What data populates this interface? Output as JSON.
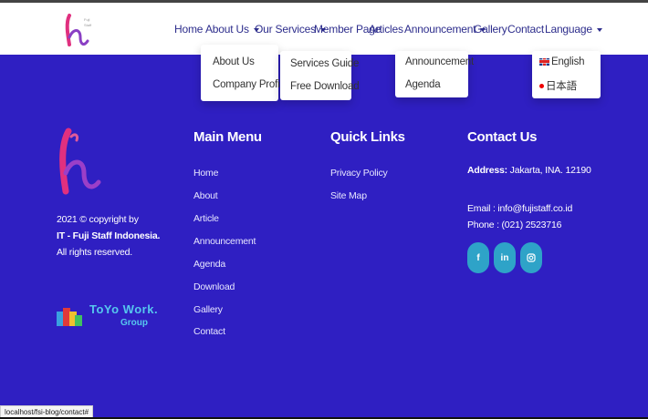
{
  "nav": {
    "home": "Home",
    "about": "About Us",
    "services": "Our Services",
    "member": "Member Page",
    "articles": "Articles",
    "announcement": "Announcement",
    "gallery": "Gallery",
    "contact": "Contact",
    "language": "Language"
  },
  "dropdowns": {
    "about": [
      "About Us",
      "Company Profile"
    ],
    "services": [
      "Services Guide",
      "Free Download"
    ],
    "announcement": [
      "Announcement",
      "Agenda"
    ],
    "language": [
      "English",
      "日本語"
    ]
  },
  "footer": {
    "copyright_line1": "2021 © copyright by",
    "copyright_line2": "IT - Fuji Staff Indonesia.",
    "copyright_line3": "All rights reserved.",
    "main_menu_title": "Main Menu",
    "main_menu": [
      "Home",
      "About",
      "Article",
      "Announcement",
      "Agenda",
      "Download",
      "Gallery",
      "Contact"
    ],
    "quick_links_title": "Quick Links",
    "quick_links": [
      "Privacy Policy",
      "Site Map"
    ],
    "contact_title": "Contact Us",
    "address_label": "Address:",
    "address_value": "Jakarta, INA. 12190",
    "email": "Email : info@fujistaff.co.id",
    "phone": "Phone : (021) 2523716",
    "social": [
      "f",
      "in",
      "ig"
    ],
    "partner_name": "ToYo Work.",
    "partner_sub": "Group"
  },
  "status_url": "localhost/fsi-blog/contact#",
  "colors": {
    "background": "#2f1fc2",
    "social": "#2ea3c8",
    "nav_text": "#2d2d8c",
    "logo_pink": "#e0307f"
  }
}
